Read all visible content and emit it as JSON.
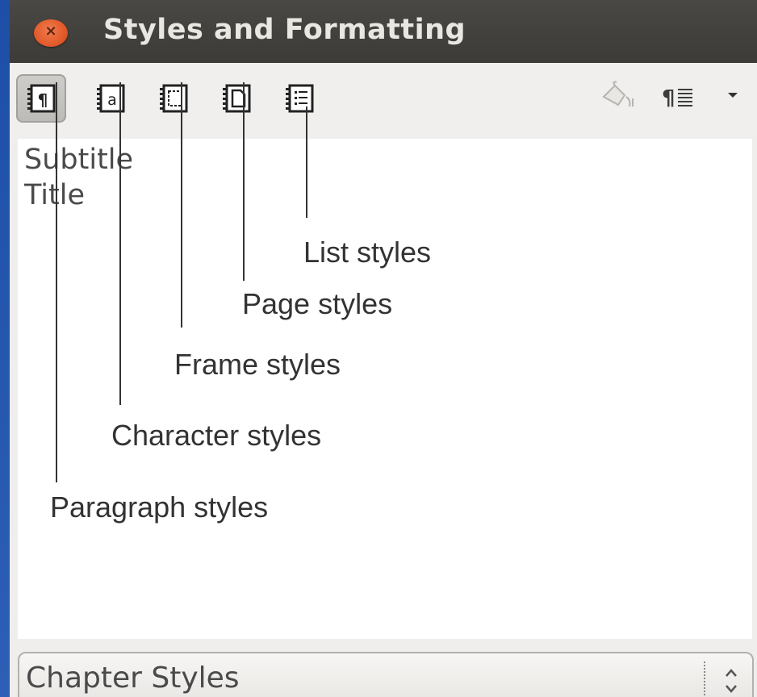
{
  "window": {
    "title": "Styles and Formatting",
    "close_symbol": "×"
  },
  "toolbar": {
    "buttons": [
      {
        "icon": "paragraph-styles-icon",
        "active": true
      },
      {
        "icon": "character-styles-icon",
        "active": false
      },
      {
        "icon": "frame-styles-icon",
        "active": false
      },
      {
        "icon": "page-styles-icon",
        "active": false
      },
      {
        "icon": "list-styles-icon",
        "active": false
      }
    ],
    "right_icons": [
      "fill-format-mode-icon",
      "new-style-from-selection-icon",
      "dropdown-arrow-icon"
    ]
  },
  "style_list": {
    "items": [
      "Subtitle",
      "Title"
    ]
  },
  "callouts": {
    "list": "List styles",
    "page": "Page styles",
    "frame": "Frame styles",
    "character": "Character styles",
    "paragraph": "Paragraph styles"
  },
  "filter": {
    "selected": "Chapter Styles"
  }
}
